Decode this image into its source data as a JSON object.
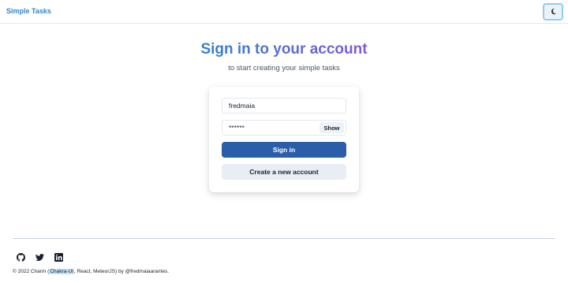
{
  "header": {
    "brand": "Simple Tasks",
    "theme_toggle_icon": "moon-icon"
  },
  "hero": {
    "title": "Sign in to your account",
    "subtitle": "to start creating your simple tasks"
  },
  "form": {
    "username_value": "fredmaia",
    "password_value": "******",
    "show_label": "Show",
    "signin_label": "Sign in",
    "create_label": "Create a new account"
  },
  "footer": {
    "social_icons": [
      "github-icon",
      "twitter-icon",
      "linkedin-icon"
    ],
    "copyright_prefix": "© 2022 Charm (",
    "copyright_highlight": "Chakra-UI",
    "copyright_suffix": ", React, MeteorJS) by @fredmaiaarantes."
  },
  "colors": {
    "brand": "#3182ce",
    "title_gradient_start": "#3182ce",
    "title_gradient_end": "#805ad5",
    "primary_button": "#2b5ea8",
    "secondary_button": "#e9eef6"
  }
}
